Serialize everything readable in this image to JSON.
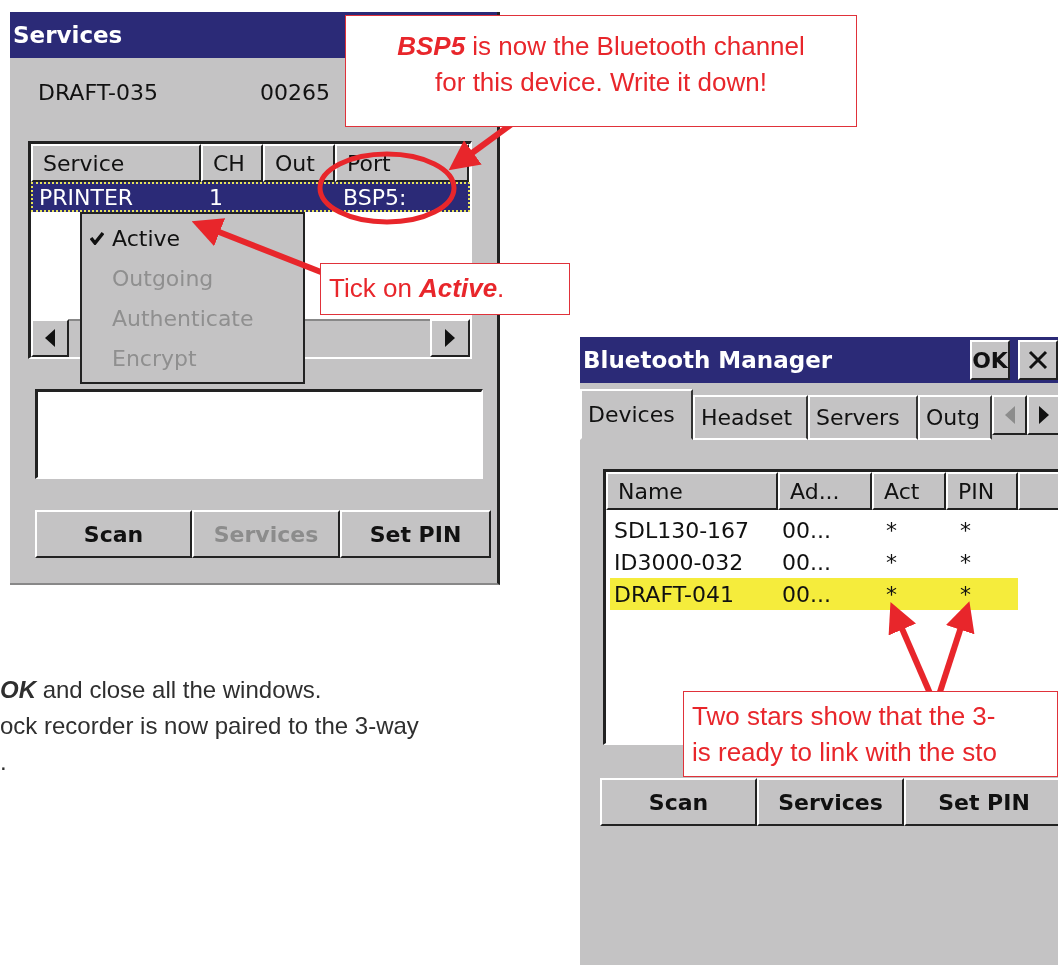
{
  "services_window": {
    "title": "Services",
    "device_name": "DRAFT-035",
    "device_address": "00265",
    "columns": [
      "Service",
      "CH",
      "Out",
      "Port"
    ],
    "rows": [
      {
        "service": "PRINTER",
        "ch": "1",
        "port": "BSP5:",
        "selected": true
      }
    ],
    "context_menu": [
      {
        "label": "Active",
        "checked": true,
        "disabled": false
      },
      {
        "label": "Outgoing",
        "checked": false,
        "disabled": true
      },
      {
        "label": "Authenticate",
        "checked": false,
        "disabled": true
      },
      {
        "label": "Encrypt",
        "checked": false,
        "disabled": true
      }
    ],
    "buttons": [
      {
        "label": "Scan",
        "disabled": false
      },
      {
        "label": "Services",
        "disabled": true
      },
      {
        "label": "Set PIN",
        "disabled": false
      }
    ]
  },
  "bluetooth_manager": {
    "title": "Bluetooth Manager",
    "ok_label": "OK",
    "tabs": [
      {
        "label": "Devices",
        "selected": true
      },
      {
        "label": "Headset",
        "selected": false
      },
      {
        "label": "Servers",
        "selected": false
      },
      {
        "label": "Outg",
        "selected": false
      }
    ],
    "columns": [
      "Name",
      "Ad...",
      "Act",
      "PIN"
    ],
    "rows": [
      {
        "name": "SDL130-167",
        "address": "00...",
        "act": "*",
        "pin": "*",
        "highlighted": false
      },
      {
        "name": "ID3000-032",
        "address": "00...",
        "act": "*",
        "pin": "*",
        "highlighted": false
      },
      {
        "name": "DRAFT-041",
        "address": "00...",
        "act": "*",
        "pin": "*",
        "highlighted": true
      }
    ],
    "buttons": [
      {
        "label": "Scan",
        "disabled": false
      },
      {
        "label": "Services",
        "disabled": false
      },
      {
        "label": "Set PIN",
        "disabled": false
      }
    ]
  },
  "callouts": [
    {
      "text": "**BSP5** is now the Bluetooth channel\nfor this device. Write it down!"
    },
    {
      "text": "Tick on **Active**."
    },
    {
      "text": "Two stars show that the 3-\nis ready to link with the sto"
    }
  ],
  "instructions": [
    "**OK** and close all the windows.",
    "ock recorder is now paired to the 3-way",
    "."
  ]
}
